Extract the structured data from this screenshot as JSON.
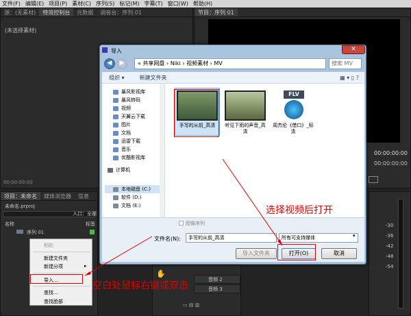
{
  "menu": [
    "文件(F)",
    "编辑(E)",
    "项目(P)",
    "素材(C)",
    "序列(S)",
    "标记(M)",
    "字幕(T)",
    "窗口(W)",
    "帮助(H)"
  ],
  "left_tabs": [
    "源：(无素材)",
    "特效控制台",
    "元数据",
    "调音台：序列 01"
  ],
  "no_clip": "(未选择素材)",
  "program_tab": "节目：序列 01",
  "src_timecode": "00:00:00:00",
  "prog_timecode_a": "00:00:00:00",
  "prog_timecode_b": "00:00:00:00",
  "project_tabs": [
    "项目：未命名",
    "媒体浏览器",
    "信息"
  ],
  "project_file": "未命名.prproj",
  "entry_label": "入口：全部",
  "col_name": "名称",
  "col_tag": "标签",
  "sequence_item": "序列 01",
  "context_menu": {
    "paste": "粘贴",
    "new_bin": "新建文件夹",
    "new_item": "新建分项",
    "import": "导入...",
    "find": "查找...",
    "find_face": "查找脸部"
  },
  "tracks": [
    "音频 2",
    "音频 3"
  ],
  "meter_labels": [
    "-30",
    "-36",
    "-42",
    "-48",
    "-54"
  ],
  "dialog": {
    "title": "导入",
    "close": "✕",
    "breadcrumb": "« 共享网盘 › Niki › 视频素材 › MV",
    "search_placeholder": "搜索 MV",
    "organize": "组织 ▾",
    "new_folder": "新建文件夹",
    "nav_items": [
      "暴风影视库",
      "暴风转码",
      "视频",
      "天翼云下载",
      "图片",
      "文档",
      "迅雷下载",
      "音乐",
      "优酷影视库"
    ],
    "computer": "计算机",
    "drives": [
      "本地磁盘 (C:)",
      "软件 (D:)",
      "文档 (E:)"
    ],
    "files": [
      {
        "name": "手写的从前_高清",
        "badge": ""
      },
      {
        "name": "听见下雨的声音_高清",
        "badge": ""
      },
      {
        "name": "周杰伦《借口》_标清",
        "badge": "FLV"
      }
    ],
    "image_sequence": "图像序列",
    "filename_label": "文件名(N):",
    "filename_value": "手写的从前_高清",
    "filetype": "所有可支持媒体",
    "import_folder_btn": "导入文件夹",
    "open_btn": "打开(O)",
    "cancel_btn": "取消"
  },
  "annotations": {
    "a1": "选择视频后打开",
    "a2": "空白处鼠标右键或双击"
  },
  "colors": {
    "annotation": "#e00000",
    "accent": "#3c7fd6"
  }
}
